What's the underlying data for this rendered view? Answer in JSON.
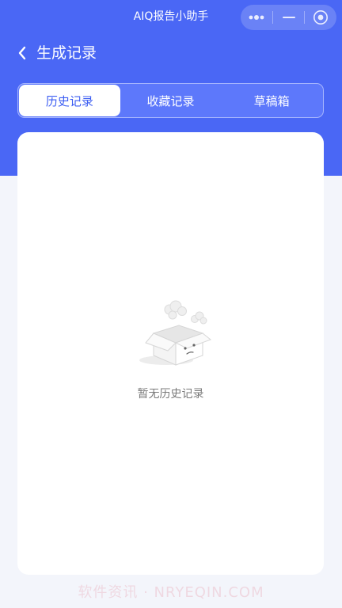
{
  "app": {
    "mini_title": "AIQ报告小助手"
  },
  "capsule": {
    "more_icon": "more-dots-icon",
    "minimize_icon": "minus-icon",
    "close_icon": "target-circle-icon"
  },
  "nav": {
    "title": "生成记录",
    "back_icon": "chevron-left-icon"
  },
  "tabs": [
    {
      "label": "历史记录",
      "active": true
    },
    {
      "label": "收藏记录",
      "active": false
    },
    {
      "label": "草稿箱",
      "active": false
    }
  ],
  "empty_state": {
    "text": "暂无历史记录",
    "icon": "empty-box-icon"
  },
  "watermark": {
    "text": "软件资讯 · NRYEQIN.COM"
  },
  "colors": {
    "primary": "#4a67f5",
    "tab_active_text": "#3d5ef2",
    "page_bg": "#f3f5fb"
  }
}
